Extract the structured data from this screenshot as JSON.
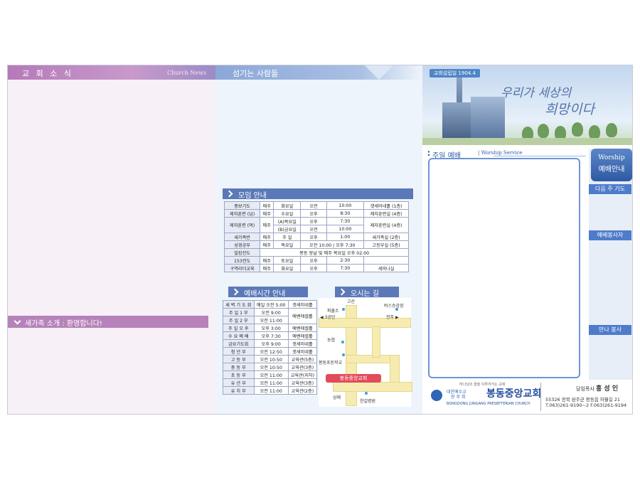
{
  "panel1": {
    "title": "교 회 소 식",
    "subtitle": "Church News",
    "new_family": "새가족 소개 : 환영합니다!"
  },
  "panel2": {
    "title": "섬기는 사람들",
    "meetings": {
      "title": "모임 안내",
      "rows": [
        [
          "중보기도",
          "매주",
          "화요일",
          "오전",
          "10:00",
          "갯세미네홀 (1층)"
        ],
        [
          "제자훈련 (남)",
          "매주",
          "수요일",
          "오후",
          "8:30",
          "제자훈련실 (4층)"
        ],
        [
          "제자훈련 (여)",
          "매주",
          "(A)목요일",
          "오후",
          "7:30",
          "제자훈련실 (4층)"
        ],
        [
          "",
          "",
          "(B)금요일",
          "오전",
          "10:00",
          ""
        ],
        [
          "새가족반",
          "매주",
          "주  일",
          "오후",
          "1:00",
          "새가족실 (2층)"
        ],
        [
          "성경공부",
          "매주",
          "목요일",
          "오전 10:00 / 오후 7:30",
          "",
          "고등부실 (5층)"
        ],
        [
          "밀킴전도",
          "봉동 장날 및 매주 목요일 오후 02:00",
          "",
          "",
          "",
          ""
        ],
        [
          "153전도",
          "매주",
          "토요일",
          "오후",
          "2:30",
          ""
        ],
        [
          "구역리더교육",
          "매주",
          "화요일",
          "오후",
          "7:30",
          "세미나실"
        ]
      ]
    },
    "worship_times": {
      "title": "예배시간 안내",
      "rows": [
        [
          "새 벽 기 도 회",
          "매일 오전 5:00",
          "갯세미네홀"
        ],
        [
          "주 일 1 부",
          "오전  9:00",
          "예벤에셀홀"
        ],
        [
          "주 일 2 부",
          "오전 11:00",
          ""
        ],
        [
          "주 일 오 후",
          "오후  3:00",
          "예벤에셀홀"
        ],
        [
          "수 요 예 배",
          "오후  7:30",
          "예벤에셀홀"
        ],
        [
          "금요기도회",
          "오후  9:00",
          "갯세미네홀"
        ],
        [
          "청   년   부",
          "오전 12:50",
          "갯세미네홀"
        ],
        [
          "고   등   부",
          "오전 10:50",
          "교육관(5층)"
        ],
        [
          "중   등   부",
          "오전 10:50",
          "교육관(3층)"
        ],
        [
          "초   등   부",
          "오전 11:00",
          "교육관(지하)"
        ],
        [
          "유   년   부",
          "오전 11:00",
          "교육관(3층)"
        ],
        [
          "유   치   부",
          "오전 11:00",
          "교육관(2층)"
        ]
      ]
    },
    "directions": {
      "title": "오시는 길",
      "labels": {
        "gosan": "고산",
        "police": "파출소",
        "bus": "버스승강장",
        "samgongdan": "◀ 3공단",
        "jeonju": "전주 ▶",
        "nonghyup": "농협",
        "school": "봉동초등학교",
        "church": "봉동중앙교회",
        "samrye": "삼례",
        "hospital": "한길병원"
      }
    }
  },
  "panel3": {
    "founded": "교회설립일 1904.4",
    "slogan_line1": "우리가 세상의",
    "slogan_line2": "희망이다",
    "worship_title": "주일 예배",
    "worship_subtitle": "| Worship Service",
    "side": {
      "btn_en": "Worship",
      "btn_ko": "예배안내",
      "next_prayer": "다음 주 기도",
      "servers": "예배봉사자",
      "fellowship": "만나 봉사"
    },
    "church": {
      "motto": "하나님의 꿈을 이루어가는 교회",
      "denom1": "대한예수교",
      "denom2": "장로회",
      "name": "봉동중앙교회",
      "name_en": "BONGDONG JUNGANG PRESBYTERIAN CHURCH",
      "pastor_label": "담임목사",
      "pastor_name": "홍 성 인",
      "address": "55326 전북 완주군 봉동읍 하월길 21",
      "tel": "T.063)261-9190~2  F.063)261-9194"
    }
  },
  "colors": {
    "panel1_accent": "#b57ab8",
    "panel2_accent": "#5b79b8",
    "panel3_accent": "#4e7ccb"
  }
}
